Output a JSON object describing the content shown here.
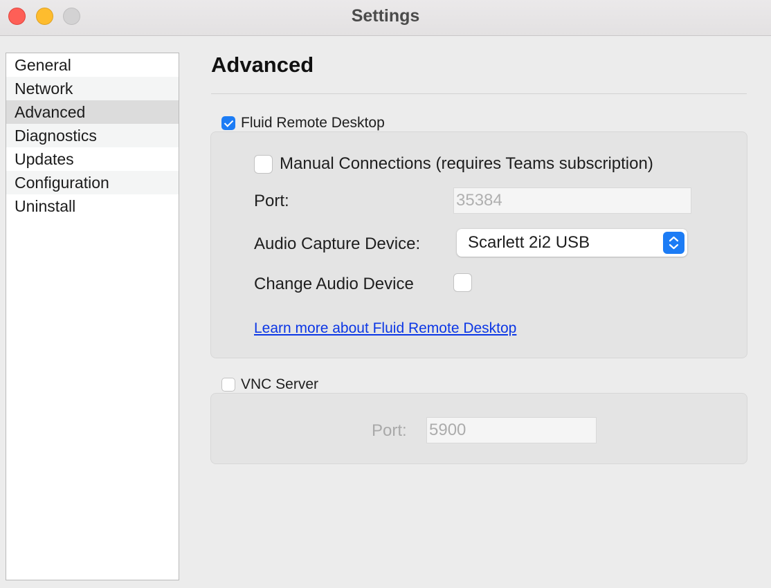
{
  "window": {
    "title": "Settings"
  },
  "sidebar": {
    "items": [
      {
        "label": "General"
      },
      {
        "label": "Network"
      },
      {
        "label": "Advanced"
      },
      {
        "label": "Diagnostics"
      },
      {
        "label": "Updates"
      },
      {
        "label": "Configuration"
      },
      {
        "label": "Uninstall"
      }
    ],
    "selected": "Advanced"
  },
  "main": {
    "heading": "Advanced",
    "fluid": {
      "label": "Fluid Remote Desktop",
      "checked": true,
      "manual_connections": {
        "label": "Manual Connections (requires Teams subscription)",
        "checked": false
      },
      "port_label": "Port:",
      "port_value": "35384",
      "audio_capture_label": "Audio Capture Device:",
      "audio_capture_value": "Scarlett 2i2 USB",
      "change_audio_label": "Change Audio Device",
      "change_audio_checked": false,
      "learn_more": "Learn more about Fluid Remote Desktop"
    },
    "vnc": {
      "label": "VNC Server",
      "checked": false,
      "port_label": "Port:",
      "port_value": "5900"
    }
  },
  "colors": {
    "accent": "#1c7cf5",
    "link": "#0b36e5"
  }
}
